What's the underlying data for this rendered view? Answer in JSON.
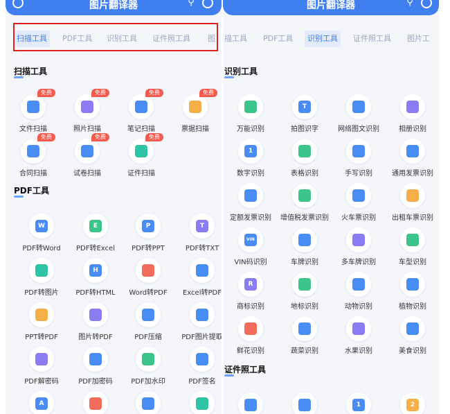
{
  "left": {
    "header": {
      "title": "图片翻译器"
    },
    "tabs": [
      {
        "label": "扫描工具",
        "active": true
      },
      {
        "label": "PDF工具",
        "active": false
      },
      {
        "label": "识别工具",
        "active": false
      },
      {
        "label": "证件照工具",
        "active": false
      },
      {
        "label": "图",
        "active": false
      }
    ],
    "scan_section": {
      "title": "扫描工具",
      "items": [
        {
          "label": "文件扫描",
          "badge": "免费",
          "icon": "file-scan-icon"
        },
        {
          "label": "照片扫描",
          "badge": "免费",
          "icon": "photo-scan-icon"
        },
        {
          "label": "笔记扫描",
          "badge": "免费",
          "icon": "note-scan-icon"
        },
        {
          "label": "票据扫描",
          "badge": "免费",
          "icon": "receipt-scan-icon"
        },
        {
          "label": "合同扫描",
          "badge": "免费",
          "icon": "contract-scan-icon"
        },
        {
          "label": "试卷扫描",
          "badge": "免费",
          "icon": "exam-scan-icon"
        },
        {
          "label": "证件扫描",
          "badge": "免费",
          "icon": "id-scan-icon"
        }
      ]
    },
    "pdf_section": {
      "title": "PDF工具",
      "items": [
        {
          "label": "PDF转Word",
          "icon": "pdf-to-word-icon",
          "glyph": "W"
        },
        {
          "label": "PDF转Excel",
          "icon": "pdf-to-excel-icon",
          "glyph": "E"
        },
        {
          "label": "PDF转PPT",
          "icon": "pdf-to-ppt-icon",
          "glyph": "P"
        },
        {
          "label": "PDF转TXT",
          "icon": "pdf-to-txt-icon",
          "glyph": "T"
        },
        {
          "label": "PDF转图片",
          "icon": "pdf-to-image-icon",
          "glyph": ""
        },
        {
          "label": "PDF转HTML",
          "icon": "pdf-to-html-icon",
          "glyph": "H"
        },
        {
          "label": "Word转PDF",
          "icon": "word-to-pdf-icon",
          "glyph": ""
        },
        {
          "label": "Excel转PDF",
          "icon": "excel-to-pdf-icon",
          "glyph": ""
        },
        {
          "label": "PPT转PDF",
          "icon": "ppt-to-pdf-icon",
          "glyph": ""
        },
        {
          "label": "图片转PDF",
          "icon": "image-to-pdf-icon",
          "glyph": ""
        },
        {
          "label": "PDF压缩",
          "icon": "pdf-compress-icon",
          "glyph": ""
        },
        {
          "label": "PDF图片提取",
          "icon": "pdf-image-extract-icon",
          "glyph": ""
        },
        {
          "label": "PDF解密码",
          "icon": "pdf-decrypt-icon",
          "glyph": ""
        },
        {
          "label": "PDF加密码",
          "icon": "pdf-encrypt-icon",
          "glyph": ""
        },
        {
          "label": "PDF加水印",
          "icon": "pdf-watermark-icon",
          "glyph": ""
        },
        {
          "label": "PDF签名",
          "icon": "pdf-sign-icon",
          "glyph": ""
        },
        {
          "label": "",
          "icon": "pdf-tool-a-icon",
          "glyph": "A"
        },
        {
          "label": "",
          "icon": "pdf-tool-doc-icon",
          "glyph": ""
        },
        {
          "label": "",
          "icon": "pdf-tool-split-icon",
          "glyph": ""
        },
        {
          "label": "",
          "icon": "pdf-tool-merge-icon",
          "glyph": ""
        }
      ]
    }
  },
  "right": {
    "header": {
      "title": "图片翻译器"
    },
    "tabs": [
      {
        "label": "描工具",
        "active": false
      },
      {
        "label": "PDF工具",
        "active": false
      },
      {
        "label": "识别工具",
        "active": true
      },
      {
        "label": "证件照工具",
        "active": false
      },
      {
        "label": "图片工",
        "active": false
      }
    ],
    "recognize_section": {
      "title": "识别工具",
      "items": [
        {
          "label": "万能识别",
          "icon": "universal-recognize-icon"
        },
        {
          "label": "拍图识字",
          "icon": "photo-text-icon",
          "glyph": "T"
        },
        {
          "label": "网络图文识别",
          "icon": "web-image-text-icon"
        },
        {
          "label": "相册识别",
          "icon": "album-recognize-icon"
        },
        {
          "label": "数字识别",
          "icon": "number-recognize-icon",
          "glyph": "1"
        },
        {
          "label": "表格识别",
          "icon": "table-recognize-icon"
        },
        {
          "label": "手写识别",
          "icon": "handwriting-recognize-icon"
        },
        {
          "label": "通用发票识别",
          "icon": "invoice-recognize-icon"
        },
        {
          "label": "定额发票识别",
          "icon": "fixed-invoice-icon"
        },
        {
          "label": "增值税发票识别",
          "icon": "vat-invoice-icon"
        },
        {
          "label": "火车票识别",
          "icon": "train-ticket-icon"
        },
        {
          "label": "出租车票识别",
          "icon": "taxi-ticket-icon"
        },
        {
          "label": "VIN码识别",
          "icon": "vin-code-icon",
          "glyph": "VIN"
        },
        {
          "label": "车牌识别",
          "icon": "license-plate-icon"
        },
        {
          "label": "多车牌识别",
          "icon": "multi-plate-icon"
        },
        {
          "label": "车型识别",
          "icon": "car-model-icon"
        },
        {
          "label": "商标识别",
          "icon": "trademark-icon",
          "glyph": "R"
        },
        {
          "label": "地标识别",
          "icon": "landmark-icon"
        },
        {
          "label": "动物识别",
          "icon": "animal-icon"
        },
        {
          "label": "植物识别",
          "icon": "plant-icon"
        },
        {
          "label": "鲜花识别",
          "icon": "flower-icon"
        },
        {
          "label": "蔬菜识别",
          "icon": "vegetable-icon"
        },
        {
          "label": "水果识别",
          "icon": "fruit-icon"
        },
        {
          "label": "美食识别",
          "icon": "food-icon"
        }
      ]
    },
    "id_photo_section": {
      "title": "证件照工具",
      "items": [
        {
          "label": "",
          "icon": "id-photo-person-icon"
        },
        {
          "label": "",
          "icon": "id-photo-settings-icon"
        },
        {
          "label": "",
          "icon": "id-photo-one-inch-icon",
          "glyph": "1"
        },
        {
          "label": "",
          "icon": "id-photo-two-inch-icon",
          "glyph": "2"
        }
      ]
    }
  }
}
